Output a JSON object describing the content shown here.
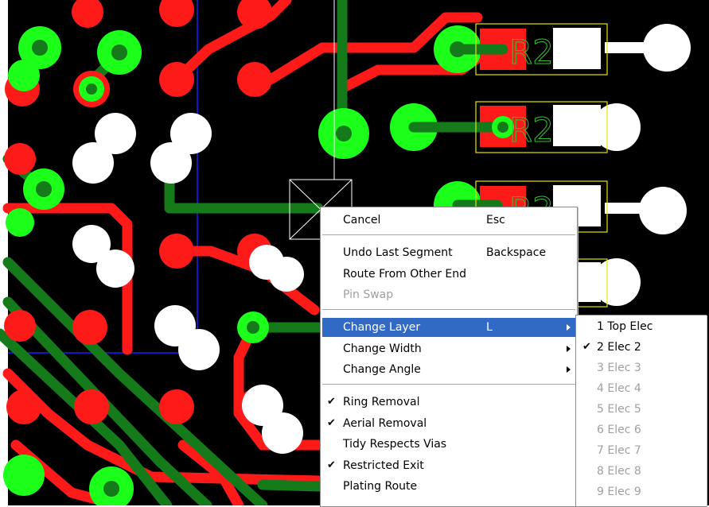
{
  "colors": {
    "board": "#000000",
    "trace_red": "#ff1a1a",
    "trace_green": "#157a1a",
    "pad_green": "#1bff1b",
    "pad_white": "#ffffff",
    "outline_yellow": "#e6e600",
    "outline_blue": "#1a1aff",
    "menu_highlight": "#316ac5"
  },
  "pcb": {
    "silkscreen_labels": [
      "R2",
      "R2",
      "R2"
    ]
  },
  "context_menu": {
    "items": [
      {
        "label": "Cancel",
        "shortcut": "Esc",
        "enabled": true,
        "checked": false,
        "submenu": false
      },
      {
        "separator": true
      },
      {
        "label": "Undo Last Segment",
        "shortcut": "Backspace",
        "enabled": true,
        "checked": false,
        "submenu": false
      },
      {
        "label": "Route From Other End",
        "shortcut": "",
        "enabled": true,
        "checked": false,
        "submenu": false
      },
      {
        "label": "Pin Swap",
        "shortcut": "",
        "enabled": false,
        "checked": false,
        "submenu": false
      },
      {
        "separator": true
      },
      {
        "label": "Change Layer",
        "shortcut": "L",
        "enabled": true,
        "checked": false,
        "submenu": true,
        "highlighted": true
      },
      {
        "label": "Change Width",
        "shortcut": "",
        "enabled": true,
        "checked": false,
        "submenu": true
      },
      {
        "label": "Change Angle",
        "shortcut": "",
        "enabled": true,
        "checked": false,
        "submenu": true
      },
      {
        "separator": true
      },
      {
        "label": "Ring Removal",
        "shortcut": "",
        "enabled": true,
        "checked": true,
        "submenu": false
      },
      {
        "label": "Aerial Removal",
        "shortcut": "",
        "enabled": true,
        "checked": true,
        "submenu": false
      },
      {
        "label": "Tidy Respects Vias",
        "shortcut": "",
        "enabled": true,
        "checked": false,
        "submenu": false
      },
      {
        "label": "Restricted Exit",
        "shortcut": "",
        "enabled": true,
        "checked": true,
        "submenu": false
      },
      {
        "label": "Plating Route",
        "shortcut": "",
        "enabled": true,
        "checked": false,
        "submenu": false
      }
    ]
  },
  "layer_submenu": {
    "items": [
      {
        "label": "1 Top Elec",
        "enabled": true,
        "checked": false
      },
      {
        "label": "2 Elec 2",
        "enabled": true,
        "checked": true
      },
      {
        "label": "3 Elec 3",
        "enabled": false,
        "checked": false
      },
      {
        "label": "4 Elec 4",
        "enabled": false,
        "checked": false
      },
      {
        "label": "5 Elec 5",
        "enabled": false,
        "checked": false
      },
      {
        "label": "6 Elec 6",
        "enabled": false,
        "checked": false
      },
      {
        "label": "7 Elec 7",
        "enabled": false,
        "checked": false
      },
      {
        "label": "8 Elec 8",
        "enabled": false,
        "checked": false
      },
      {
        "label": "9 Elec 9",
        "enabled": false,
        "checked": false
      }
    ]
  },
  "icons": {
    "check": "checkmark-icon",
    "submenu_arrow": "submenu-arrow-icon"
  }
}
